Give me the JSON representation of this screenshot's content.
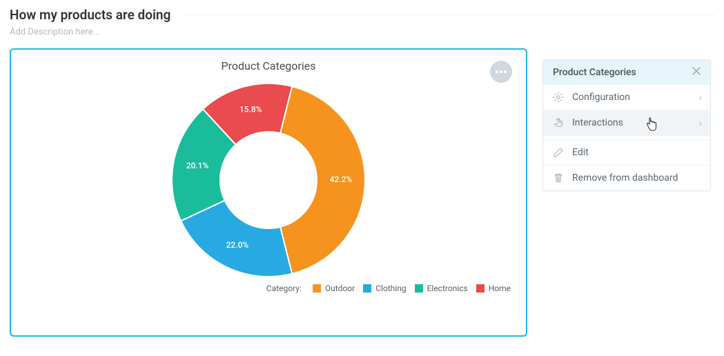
{
  "page_title": "How my products are doing",
  "page_description_placeholder": "Add Description here...",
  "chart_title": "Product Categories",
  "legend_label": "Category:",
  "context_menu": {
    "header": "Product Categories",
    "items": [
      {
        "label": "Configuration",
        "icon": "gear-icon",
        "has_submenu": true
      },
      {
        "label": "Interactions",
        "icon": "hand-tap-icon",
        "has_submenu": true,
        "hover": true
      },
      {
        "label": "Edit",
        "icon": "pencil-icon",
        "has_submenu": false
      },
      {
        "label": "Remove from dashboard",
        "icon": "trash-icon",
        "has_submenu": false
      }
    ]
  },
  "colors": {
    "outdoor": "#f5931e",
    "clothing": "#27aae1",
    "electronics": "#1bbc9b",
    "home": "#e94b4e"
  },
  "chart_data": {
    "type": "pie",
    "title": "Product Categories",
    "series_name": "Category",
    "categories": [
      "Outdoor",
      "Clothing",
      "Electronics",
      "Home"
    ],
    "values": [
      42.2,
      22.0,
      20.1,
      15.8
    ],
    "value_suffix": "%",
    "slice_labels": [
      "42.2%",
      "22.0%",
      "20.1%",
      "15.8%"
    ],
    "colors": [
      "#f5931e",
      "#27aae1",
      "#1bbc9b",
      "#e94b4e"
    ],
    "donut": true
  }
}
